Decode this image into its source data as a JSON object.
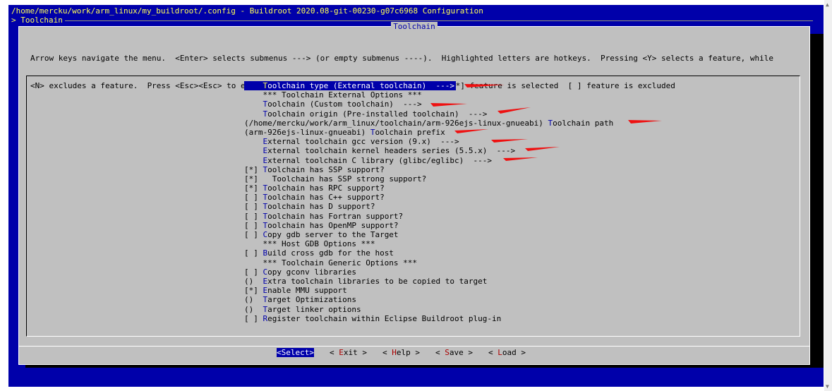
{
  "window": {
    "title": "/home/mercku/work/arm_linux/my_buildroot/.config - Buildroot 2020.08-git-00230-g07c6968 Configuration",
    "breadcrumb": "> Toolchain"
  },
  "dialog": {
    "title": "Toolchain",
    "help_line1": "Arrow keys navigate the menu.  <Enter> selects submenus ---> (or empty submenus ----).  Highlighted letters are hotkeys.  Pressing <Y> selects a feature, while",
    "help_line2": "<N> excludes a feature.  Press <Esc><Esc> to exit, <?> for Help, </> for Search.  Legend: [*] feature is selected  [ ] feature is excluded"
  },
  "menu": {
    "items": [
      {
        "prefix": "    ",
        "hotkey": "T",
        "rest": "oolchain type (External toolchain)  --->",
        "selected": true
      },
      {
        "prefix": "    ",
        "hotkey": "",
        "rest": "*** Toolchain External Options ***"
      },
      {
        "prefix": "    ",
        "hotkey": "T",
        "rest": "oolchain (Custom toolchain)  --->"
      },
      {
        "prefix": "    ",
        "hotkey": "T",
        "rest": "oolchain origin (Pre-installed toolchain)  --->"
      },
      {
        "prefix": "(/home/mercku/work/arm_linux/toolchain/arm-926ejs-linux-gnueabi) ",
        "hotkey": "T",
        "rest": "oolchain path"
      },
      {
        "prefix": "(arm-926ejs-linux-gnueabi) ",
        "hotkey": "T",
        "rest": "oolchain prefix"
      },
      {
        "prefix": "    ",
        "hotkey": "E",
        "rest": "xternal toolchain gcc version (9.x)  --->"
      },
      {
        "prefix": "    ",
        "hotkey": "E",
        "rest": "xternal toolchain kernel headers series (5.5.x)  --->"
      },
      {
        "prefix": "    ",
        "hotkey": "E",
        "rest": "xternal toolchain C library (glibc/eglibc)  --->"
      },
      {
        "prefix": "[*] ",
        "hotkey": "T",
        "rest": "oolchain has SSP support?"
      },
      {
        "prefix": "[*]   ",
        "hotkey": "",
        "rest": "Toolchain has SSP strong support?"
      },
      {
        "prefix": "[*] ",
        "hotkey": "T",
        "rest": "oolchain has RPC support?"
      },
      {
        "prefix": "[ ] ",
        "hotkey": "T",
        "rest": "oolchain has C++ support?"
      },
      {
        "prefix": "[ ] ",
        "hotkey": "T",
        "rest": "oolchain has D support?"
      },
      {
        "prefix": "[ ] ",
        "hotkey": "T",
        "rest": "oolchain has Fortran support?"
      },
      {
        "prefix": "[ ] ",
        "hotkey": "T",
        "rest": "oolchain has OpenMP support?"
      },
      {
        "prefix": "[ ] ",
        "hotkey": "C",
        "rest": "opy gdb server to the Target"
      },
      {
        "prefix": "    ",
        "hotkey": "",
        "rest": "*** Host GDB Options ***"
      },
      {
        "prefix": "[ ] ",
        "hotkey": "B",
        "rest": "uild cross gdb for the host"
      },
      {
        "prefix": "    ",
        "hotkey": "",
        "rest": "*** Toolchain Generic Options ***"
      },
      {
        "prefix": "[ ] ",
        "hotkey": "C",
        "rest": "opy gconv libraries"
      },
      {
        "prefix": "()  ",
        "hotkey": "E",
        "rest": "xtra toolchain libraries to be copied to target"
      },
      {
        "prefix": "[*] ",
        "hotkey": "E",
        "rest": "nable MMU support"
      },
      {
        "prefix": "()  ",
        "hotkey": "T",
        "rest": "arget Optimizations"
      },
      {
        "prefix": "()  ",
        "hotkey": "T",
        "rest": "arget linker options"
      },
      {
        "prefix": "[ ] ",
        "hotkey": "R",
        "rest": "egister toolchain within Eclipse Buildroot plug-in"
      }
    ]
  },
  "buttons": [
    {
      "open": "<",
      "hotkey": "S",
      "rest": "elect",
      "close": ">",
      "selected": true
    },
    {
      "open": "< ",
      "hotkey": "E",
      "rest": "xit",
      "close": " >"
    },
    {
      "open": "< ",
      "hotkey": "H",
      "rest": "elp",
      "close": " >"
    },
    {
      "open": "< ",
      "hotkey": "S",
      "rest": "ave",
      "close": " >"
    },
    {
      "open": "< ",
      "hotkey": "L",
      "rest": "oad",
      "close": " >"
    }
  ],
  "colors": {
    "terminal_bg": "#0000aa",
    "dialog_bg": "#c0c0c0",
    "title_text": "#ffff55",
    "annotation_arrow": "#ee1111"
  }
}
